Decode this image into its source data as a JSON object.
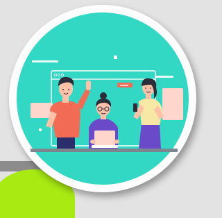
{
  "illustration": {
    "subject": "three-people-collaborating-around-laptop",
    "colors": {
      "circle_fill": "#33d8c5",
      "ring": "#fdfdfd",
      "background": "#e3e3e3",
      "accent_green": "#a8ea12",
      "shirt_orange": "#f26c55",
      "shirt_purple": "#6a4ac8",
      "shirt_yellow": "#f7e8a6",
      "skin": "#ffc1a8",
      "hair": "#2d2d3a",
      "floor": "#7c8790"
    }
  }
}
